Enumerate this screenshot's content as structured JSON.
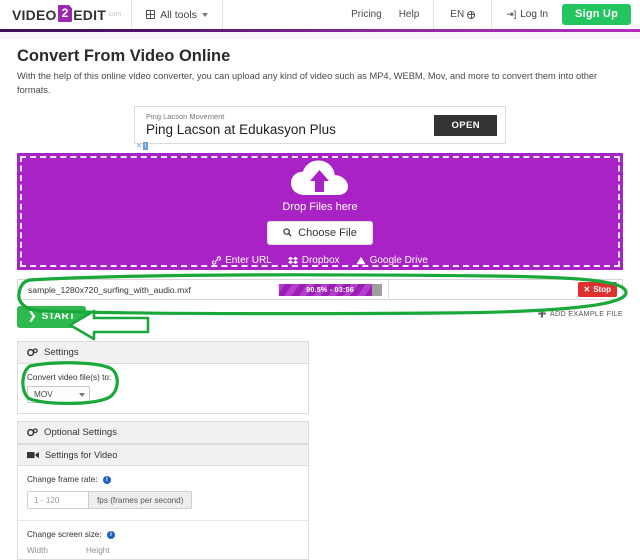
{
  "header": {
    "logo": {
      "part1": "VIDEO",
      "badge": "2",
      "part2": "EDIT",
      "tld": ".com"
    },
    "all_tools": "All tools",
    "nav": [
      {
        "label": "Pricing"
      },
      {
        "label": "Help"
      }
    ],
    "language": "EN",
    "login": "Log In",
    "signup": "Sign Up",
    "accent_purple": "#8e2a9e",
    "accent_green": "#22c55e"
  },
  "page": {
    "title": "Convert From Video Online",
    "description": "With the help of this online video converter, you can upload any kind of video such as MP4, WEBM, Mov, and more to convert them into other formats."
  },
  "ad": {
    "kicker": "Ping Lacson Movement",
    "title": "Ping Lacson at Edukasyon Plus",
    "button": "OPEN",
    "close_mark": "✕",
    "info_mark": "i"
  },
  "dropzone": {
    "label": "Drop Files here",
    "choose_file": "Choose File",
    "background": "#a822c6",
    "sources": [
      {
        "label": "Enter URL",
        "icon": "link-icon"
      },
      {
        "label": "Dropbox",
        "icon": "dropbox-icon"
      },
      {
        "label": "Google Drive",
        "icon": "google-drive-icon"
      }
    ]
  },
  "file_row": {
    "filename": "sample_1280x720_surfing_with_audio.mxf",
    "progress_percent": 90.5,
    "progress_text": "90.5% - 03:56",
    "time_remaining": "03:56",
    "stop_label": "Stop",
    "progress_color": "#9b1fb5"
  },
  "actions": {
    "start": "START",
    "add_example_file": "ADD EXAMPLE FILE"
  },
  "settings": {
    "title": "Settings",
    "convert_label": "Convert video file(s) to:",
    "format_value": "MOV"
  },
  "optional_settings": {
    "title": "Optional Settings",
    "video_section": "Settings for Video",
    "frame_rate_label": "Change frame rate:",
    "frame_rate_placeholder": "1 - 120",
    "frame_rate_suffix": "fps (frames per second)",
    "screen_size_label": "Change screen size:",
    "width_label": "Width",
    "height_label": "Height"
  },
  "annotations": {
    "color": "#19a83a",
    "items": [
      {
        "name": "file-row-highlight"
      },
      {
        "name": "start-button-arrow"
      },
      {
        "name": "format-select-highlight"
      }
    ]
  }
}
